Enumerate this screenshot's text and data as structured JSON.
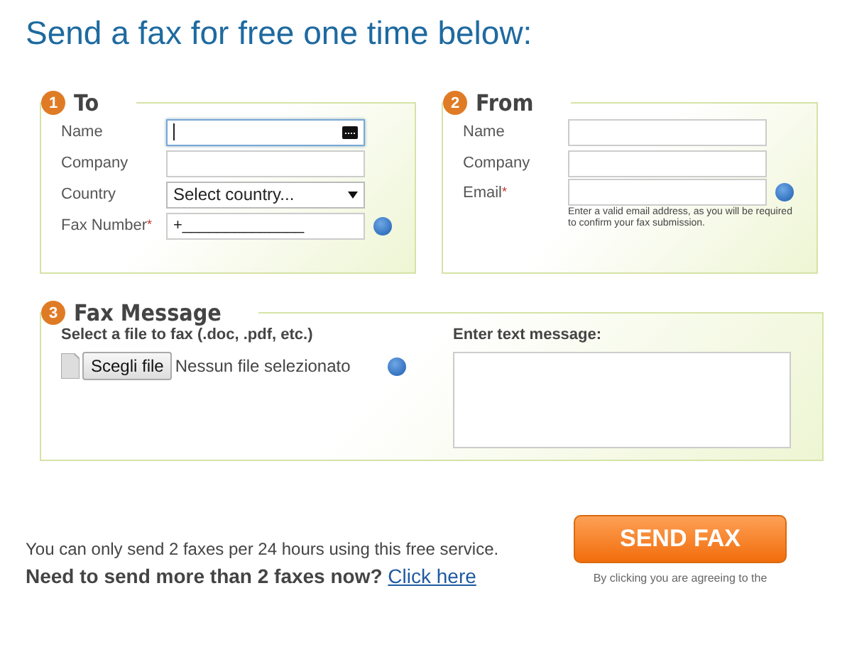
{
  "title": "Send a fax for free one time below:",
  "to": {
    "number": "1",
    "heading": "To",
    "fields": [
      {
        "kind": "text",
        "label": "Name",
        "focused": true
      },
      {
        "kind": "text",
        "label": "Company",
        "focused": false
      },
      {
        "kind": "select",
        "label": "Country",
        "value": "Select country...",
        "focused": false
      },
      {
        "kind": "text",
        "label": "Fax Number",
        "mark": "*",
        "value": "+______________",
        "focused": false,
        "info": true
      }
    ]
  },
  "from": {
    "number": "2",
    "heading": "From",
    "fields": [
      {
        "kind": "text",
        "label": "Name",
        "focused": false
      },
      {
        "kind": "text",
        "label": "Company",
        "focused": false
      },
      {
        "kind": "text",
        "label": "Email",
        "mark": "*",
        "focused": false,
        "info": true,
        "hint": "Enter a valid email address, as you will be required to confirm your fax submission."
      }
    ]
  },
  "message": {
    "number": "3",
    "heading": "Fax Message",
    "file_label": "Select a file to fax (.doc, .pdf, etc.)",
    "file_button": "Scegli file",
    "file_status": "Nessun file selezionato",
    "text_label": "Enter text message:"
  },
  "footer": {
    "limit": "You can only send 2 faxes per 24 hours using this free service.",
    "more": "Need to send more than 2 faxes now?",
    "link": "Click here",
    "button": "SEND FAX",
    "agree": "By clicking you are agreeing to the"
  }
}
